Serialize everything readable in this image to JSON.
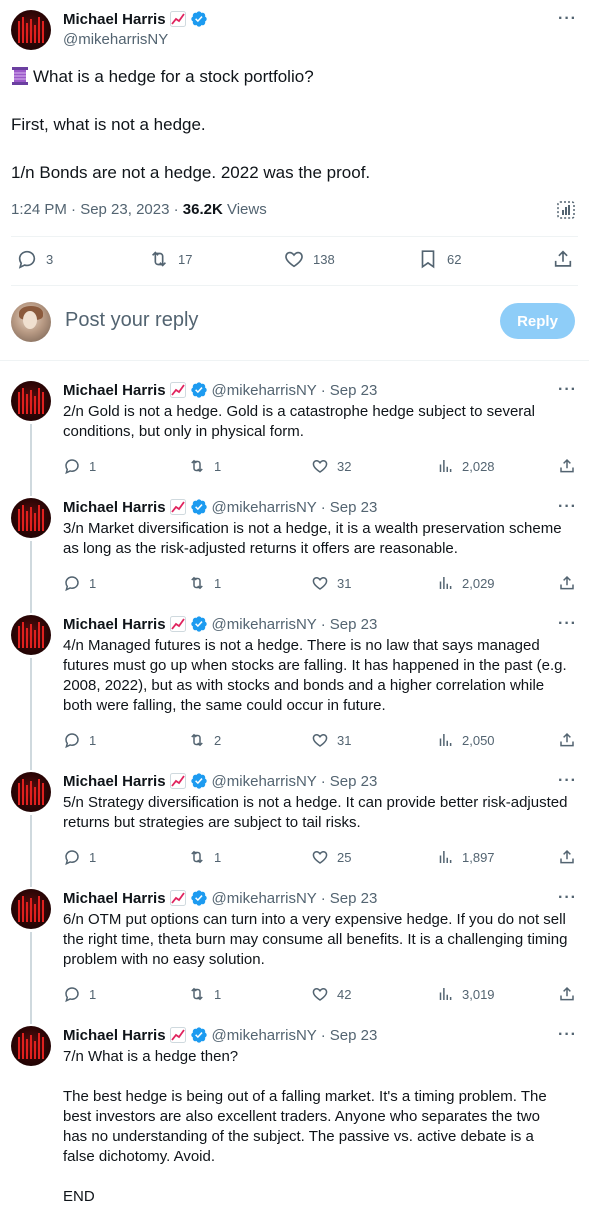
{
  "main_tweet": {
    "author_name": "Michael Harris",
    "handle": "@mikeharrisNY",
    "paragraphs": [
      "What is a hedge for a stock portfolio?",
      "First, what is not a hedge.",
      "1/n Bonds are not a hedge. 2022 was the proof."
    ],
    "time": "1:24 PM · Sep 23, 2023 · ",
    "views_count": "36.2K",
    "views_label": " Views",
    "stats": {
      "replies": "3",
      "retweets": "17",
      "likes": "138",
      "bookmarks": "62"
    }
  },
  "composer": {
    "placeholder": "Post your reply",
    "button_label": "Reply"
  },
  "replies": [
    {
      "name": "Michael Harris",
      "handle": "@mikeharrisNY",
      "date": "Sep 23",
      "paragraphs": [
        "2/n Gold is not a hedge. Gold is a catastrophe hedge subject to several conditions, but only in physical form."
      ],
      "replies": "1",
      "retweets": "1",
      "likes": "32",
      "views": "2,028"
    },
    {
      "name": "Michael Harris",
      "handle": "@mikeharrisNY",
      "date": "Sep 23",
      "paragraphs": [
        "3/n Market diversification is not a hedge, it is a wealth preservation scheme as long as the risk-adjusted returns it offers are reasonable."
      ],
      "replies": "1",
      "retweets": "1",
      "likes": "31",
      "views": "2,029"
    },
    {
      "name": "Michael Harris",
      "handle": "@mikeharrisNY",
      "date": "Sep 23",
      "paragraphs": [
        "4/n Managed futures is not a hedge. There is no law that says managed futures must go up when stocks are falling. It has happened in the past (e.g. 2008, 2022), but as with stocks and bonds and a higher correlation while both were falling, the same could occur in future."
      ],
      "replies": "1",
      "retweets": "2",
      "likes": "31",
      "views": "2,050"
    },
    {
      "name": "Michael Harris",
      "handle": "@mikeharrisNY",
      "date": "Sep 23",
      "paragraphs": [
        "5/n Strategy diversification is not a hedge. It can provide better risk-adjusted returns but strategies are subject to tail risks."
      ],
      "replies": "1",
      "retweets": "1",
      "likes": "25",
      "views": "1,897"
    },
    {
      "name": "Michael Harris",
      "handle": "@mikeharrisNY",
      "date": "Sep 23",
      "paragraphs": [
        "6/n OTM put options can turn into a very expensive hedge. If you do not sell the right time, theta burn may consume all benefits. It is a challenging timing problem with no easy solution."
      ],
      "replies": "1",
      "retweets": "1",
      "likes": "42",
      "views": "3,019"
    },
    {
      "name": "Michael Harris",
      "handle": "@mikeharrisNY",
      "date": "Sep 23",
      "paragraphs": [
        "7/n What is a hedge then?",
        "The best hedge is being out of a falling market. It's a timing problem. The best investors are also excellent traders. Anyone who separates the two has no understanding of the subject. The passive vs. active debate is a false dichotomy. Avoid.",
        "END"
      ]
    }
  ],
  "colors": {
    "accent": "#1d9bf0",
    "muted": "#536471",
    "reply_button": "#8ecdf8",
    "text": "#0f1419"
  },
  "icons": [
    "chart-emoji",
    "verified-badge-icon",
    "more-icon",
    "thread-icon",
    "analytics-icon",
    "reply-icon",
    "retweet-icon",
    "like-icon",
    "bookmark-icon",
    "share-icon",
    "views-icon"
  ]
}
